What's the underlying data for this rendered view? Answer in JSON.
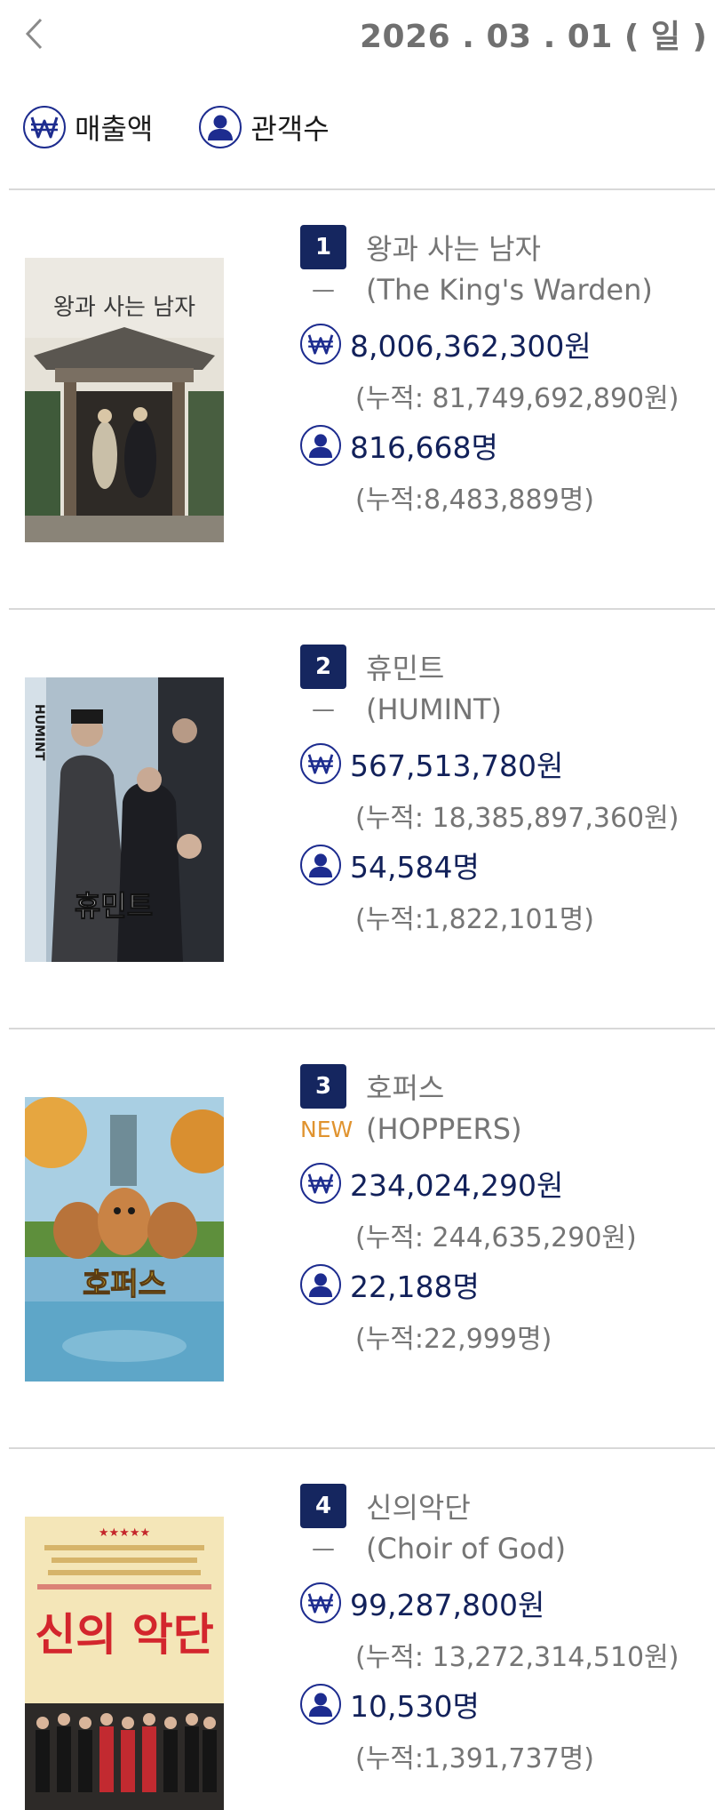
{
  "header": {
    "date": "2026 . 03 . 01 ( 일 )"
  },
  "legend": {
    "sales_label": "매출액",
    "audience_label": "관객수"
  },
  "colors": {
    "accent": "#1d2c8f",
    "rank_badge": "#15265f",
    "new_badge": "#e0932f",
    "value_text": "#12215a"
  },
  "movies": [
    {
      "rank": "1",
      "title": "왕과 사는 남자",
      "change": "—",
      "en_title": "(The King's Warden)",
      "sales": "8,006,362,300원",
      "sales_cum": "(누적: 81,749,692,890원)",
      "audience": "816,668명",
      "audience_cum": "(누적:8,483,889명)",
      "poster_title": "왕과 사는 남자"
    },
    {
      "rank": "2",
      "title": "휴민트",
      "change": "—",
      "en_title": "(HUMINT)",
      "sales": "567,513,780원",
      "sales_cum": "(누적: 18,385,897,360원)",
      "audience": "54,584명",
      "audience_cum": "(누적:1,822,101명)",
      "poster_title": "휴민트",
      "poster_side": "HUMINT"
    },
    {
      "rank": "3",
      "title": "호퍼스",
      "change": "NEW",
      "en_title": "(HOPPERS)",
      "sales": "234,024,290원",
      "sales_cum": "(누적: 244,635,290원)",
      "audience": "22,188명",
      "audience_cum": "(누적:22,999명)",
      "poster_title": "호퍼스"
    },
    {
      "rank": "4",
      "title": "신의악단",
      "change": "—",
      "en_title": "(Choir of God)",
      "sales": "99,287,800원",
      "sales_cum": "(누적: 13,272,314,510원)",
      "audience": "10,530명",
      "audience_cum": "(누적:1,391,737명)",
      "poster_title": "신의 악단",
      "poster_stars": "★★★★★"
    }
  ]
}
